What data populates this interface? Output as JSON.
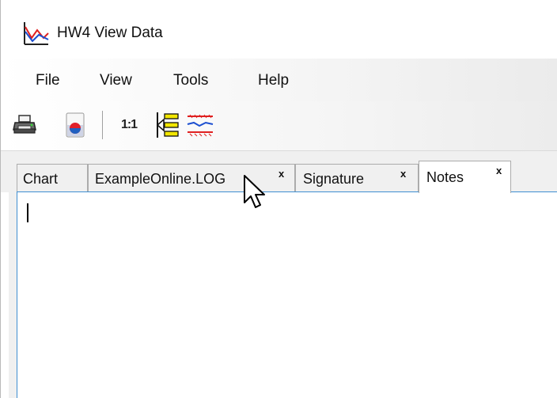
{
  "window": {
    "title": "HW4 View Data",
    "app_icon": "line-chart-app-icon"
  },
  "menubar": {
    "items": [
      {
        "label": "File"
      },
      {
        "label": "View"
      },
      {
        "label": "Tools"
      },
      {
        "label": "Help"
      }
    ]
  },
  "toolbar": {
    "buttons": [
      {
        "icon": "printer-icon"
      },
      {
        "icon": "record-icon"
      },
      {
        "label": "1:1"
      },
      {
        "icon": "legend-icon"
      },
      {
        "icon": "limit-lines-icon"
      }
    ]
  },
  "tabs": [
    {
      "label": "Chart",
      "closable": false,
      "active": false
    },
    {
      "label": "ExampleOnline.LOG",
      "close_label": "x",
      "closable": true,
      "active": false
    },
    {
      "label": "Signature",
      "close_label": "x",
      "closable": true,
      "active": false
    },
    {
      "label": "Notes",
      "close_label": "x",
      "closable": true,
      "active": true
    }
  ],
  "notes": {
    "content": ""
  },
  "colors": {
    "focus_border": "#3f8fd2",
    "record_red": "#e0202a",
    "record_blue": "#2060c0",
    "legend_yellow": "#f2e600",
    "limit_red": "#e02020",
    "limit_blue": "#1c4fd0"
  }
}
